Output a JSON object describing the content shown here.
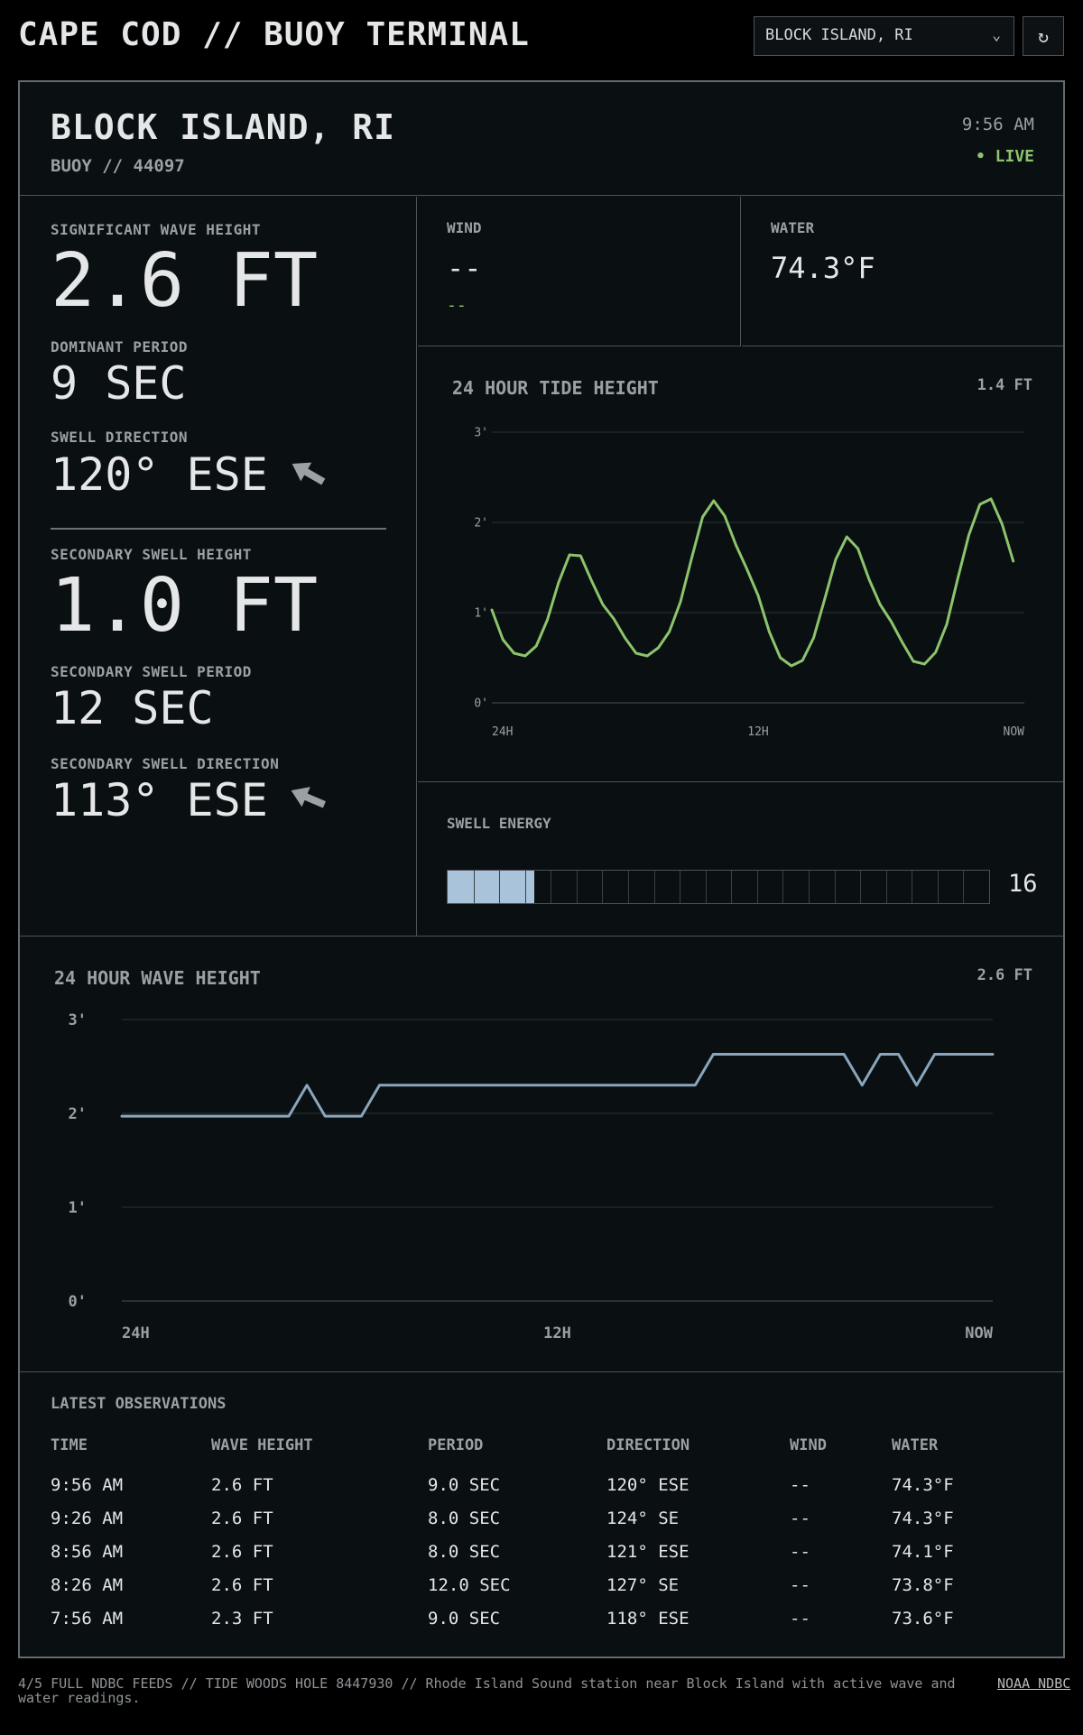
{
  "app": {
    "title": "CAPE COD // BUOY TERMINAL",
    "station_select": "BLOCK ISLAND, RI",
    "refresh_icon": "refresh-icon",
    "chevron_icon": "chevron-down-icon"
  },
  "station": {
    "name": "BLOCK ISLAND, RI",
    "buoy": "BUOY // 44097",
    "time": "9:56 AM",
    "live": "• LIVE"
  },
  "primary": {
    "wave_height_label": "SIGNIFICANT WAVE HEIGHT",
    "wave_height": "2.6 FT",
    "period_label": "DOMINANT PERIOD",
    "period": "9 SEC",
    "direction_label": "SWELL DIRECTION",
    "direction": "120° ESE",
    "direction_degrees": 120
  },
  "secondary": {
    "height_label": "SECONDARY SWELL HEIGHT",
    "height": "1.0 FT",
    "period_label": "SECONDARY SWELL PERIOD",
    "period": "12 SEC",
    "direction_label": "SECONDARY SWELL DIRECTION",
    "direction": "113° ESE",
    "direction_degrees": 113
  },
  "wind": {
    "label": "WIND",
    "value": "--",
    "sub": "--"
  },
  "water": {
    "label": "WATER",
    "value": "74.3°F"
  },
  "tide": {
    "title": "24 HOUR TIDE HEIGHT",
    "readout": "1.4 FT"
  },
  "energy": {
    "label": "SWELL ENERGY",
    "value": "16",
    "fraction": 0.16,
    "segments": 21
  },
  "wave": {
    "title": "24 HOUR WAVE HEIGHT",
    "readout": "2.6 FT"
  },
  "colors": {
    "tide_line": "#8cc46c",
    "wave_line": "#8aa6bd",
    "energy_fill": "#a9c4da",
    "live": "#8cc46c",
    "grid": "#2a3034",
    "arrow": "#9ba1a5"
  },
  "chart_data": [
    {
      "type": "line",
      "title": "24 HOUR TIDE HEIGHT",
      "ylim": [
        0,
        3
      ],
      "yticks": [
        "0'",
        "1'",
        "2'",
        "3'"
      ],
      "xticks": [
        "24H",
        "12H",
        "NOW"
      ],
      "grid": true,
      "x": [
        0,
        0.5,
        1,
        1.5,
        2,
        2.5,
        3,
        3.5,
        4,
        4.5,
        5,
        5.5,
        6,
        6.5,
        7,
        7.5,
        8,
        8.5,
        9,
        9.5,
        10,
        10.5,
        11,
        11.5,
        12,
        12.5,
        13,
        13.5,
        14,
        14.5,
        15,
        15.5,
        16,
        16.5,
        17,
        17.5,
        18,
        18.5,
        19,
        19.5,
        20,
        20.5,
        21,
        21.5,
        22,
        22.5,
        23,
        23.5,
        24
      ],
      "y": [
        1.03,
        0.7,
        0.55,
        0.52,
        0.63,
        0.92,
        1.33,
        1.64,
        1.63,
        1.35,
        1.09,
        0.93,
        0.72,
        0.55,
        0.52,
        0.61,
        0.79,
        1.12,
        1.6,
        2.06,
        2.24,
        2.07,
        1.75,
        1.48,
        1.19,
        0.79,
        0.5,
        0.41,
        0.47,
        0.72,
        1.15,
        1.59,
        1.84,
        1.71,
        1.37,
        1.09,
        0.9,
        0.67,
        0.46,
        0.43,
        0.56,
        0.87,
        1.38,
        1.86,
        2.2,
        2.26,
        1.98,
        1.57
      ]
    },
    {
      "type": "line",
      "title": "24 HOUR WAVE HEIGHT",
      "ylim": [
        0,
        3
      ],
      "yticks": [
        "0'",
        "1'",
        "2'",
        "3'"
      ],
      "xticks": [
        "24H",
        "12H",
        "NOW"
      ],
      "grid": true,
      "x": [
        0,
        4.6,
        5.1,
        5.6,
        6.6,
        7.1,
        15.8,
        16.3,
        19.9,
        20.4,
        20.9,
        21.4,
        21.9,
        22.4,
        24
      ],
      "y": [
        1.97,
        1.97,
        2.3,
        1.97,
        1.97,
        2.3,
        2.3,
        2.63,
        2.63,
        2.3,
        2.63,
        2.63,
        2.3,
        2.63,
        2.63
      ]
    }
  ],
  "observations": {
    "title": "LATEST OBSERVATIONS",
    "headers": [
      "TIME",
      "WAVE HEIGHT",
      "PERIOD",
      "DIRECTION",
      "WIND",
      "WATER"
    ],
    "rows": [
      [
        "9:56 AM",
        "2.6 FT",
        "9.0 SEC",
        "120° ESE",
        "--",
        "74.3°F"
      ],
      [
        "9:26 AM",
        "2.6 FT",
        "8.0 SEC",
        "124° SE",
        "--",
        "74.3°F"
      ],
      [
        "8:56 AM",
        "2.6 FT",
        "8.0 SEC",
        "121° ESE",
        "--",
        "74.1°F"
      ],
      [
        "8:26 AM",
        "2.6 FT",
        "12.0 SEC",
        "127° SE",
        "--",
        "73.8°F"
      ],
      [
        "7:56 AM",
        "2.3 FT",
        "9.0 SEC",
        "118° ESE",
        "--",
        "73.6°F"
      ]
    ]
  },
  "footer": {
    "text": "4/5 FULL NDBC FEEDS // TIDE WOODS HOLE 8447930 // Rhode Island Sound station near Block Island with active wave and water readings.",
    "link": "NOAA NDBC"
  }
}
